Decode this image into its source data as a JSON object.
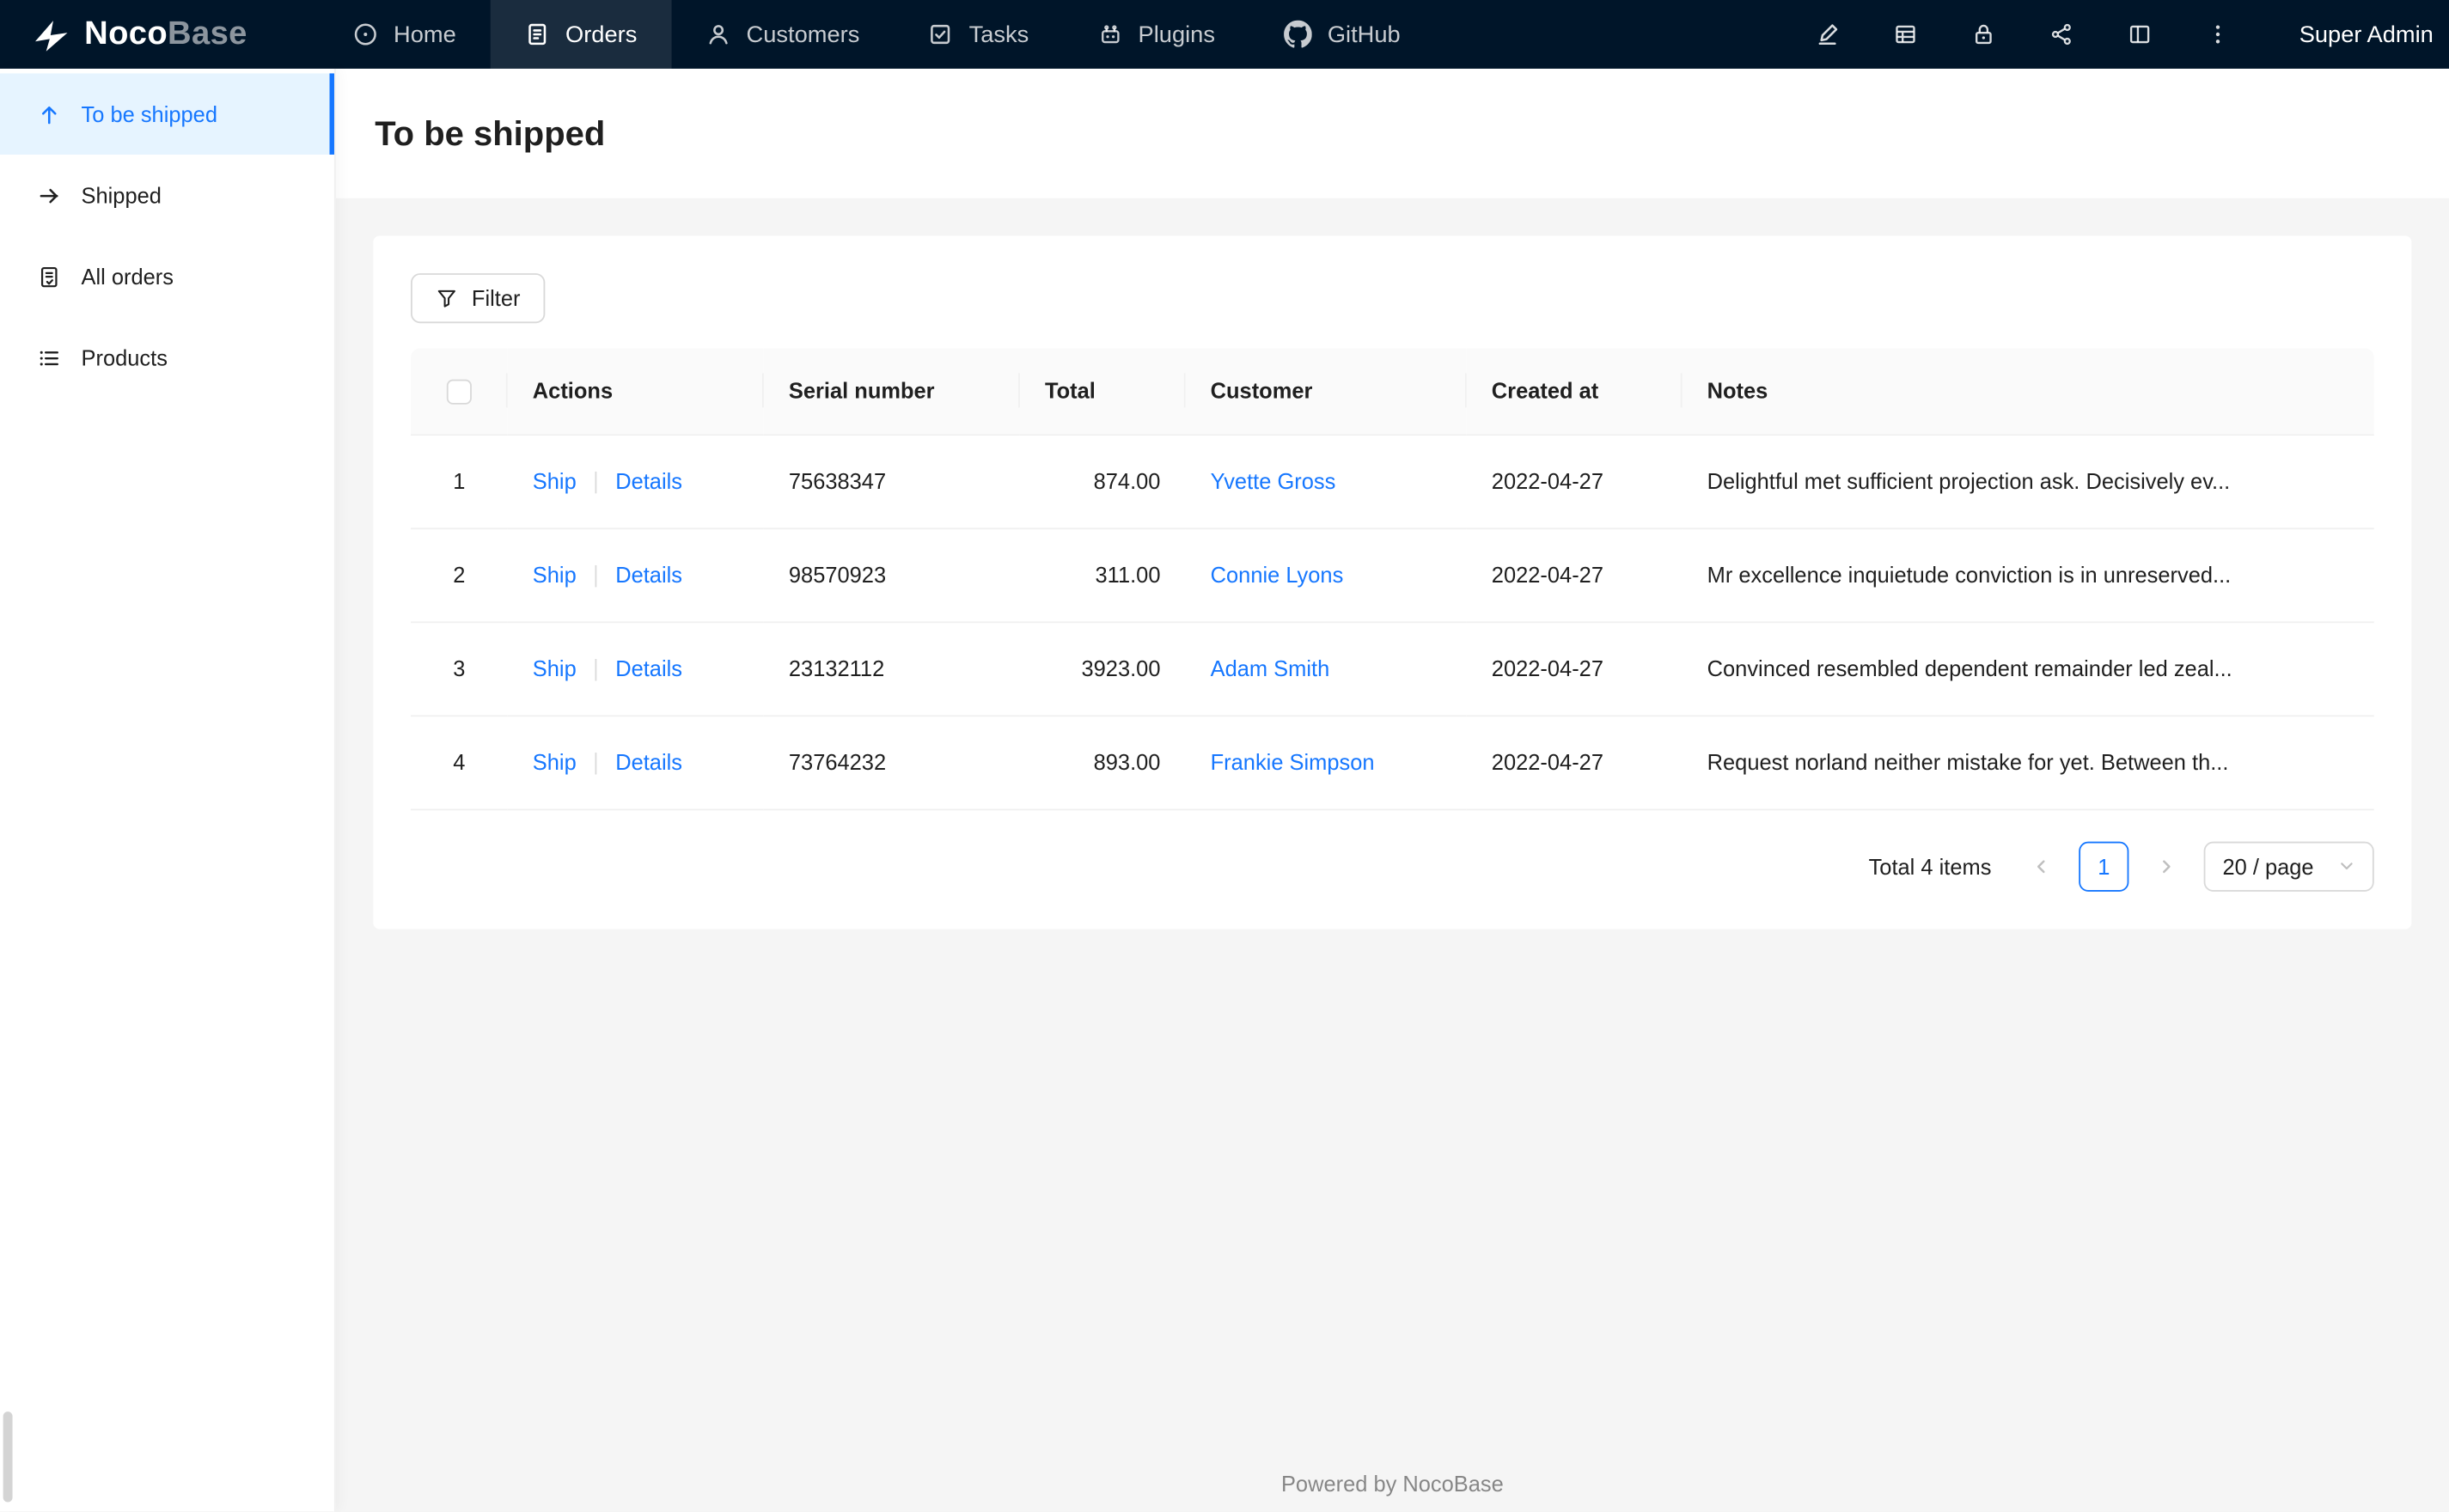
{
  "colors": {
    "accent": "#1677ff",
    "nav_bg": "#001529",
    "sidebar_selected_bg": "#e6f4ff",
    "content_bg": "#f5f5f5"
  },
  "topnav": {
    "brand": {
      "bold": "Noco",
      "light": "Base"
    },
    "items": [
      {
        "label": "Home",
        "icon": "home-icon",
        "active": false
      },
      {
        "label": "Orders",
        "icon": "orders-icon",
        "active": true
      },
      {
        "label": "Customers",
        "icon": "customers-icon",
        "active": false
      },
      {
        "label": "Tasks",
        "icon": "tasks-icon",
        "active": false
      },
      {
        "label": "Plugins",
        "icon": "plugins-icon",
        "active": false
      },
      {
        "label": "GitHub",
        "icon": "github-icon",
        "active": false
      }
    ],
    "right_icons": [
      "highlighter-icon",
      "collections-icon",
      "lock-icon",
      "nodes-icon",
      "layout-icon",
      "more-icon"
    ],
    "user": "Super Admin"
  },
  "sidebar": {
    "items": [
      {
        "label": "To be shipped",
        "icon": "arrow-up-icon",
        "active": true
      },
      {
        "label": "Shipped",
        "icon": "arrow-right-icon",
        "active": false
      },
      {
        "label": "All orders",
        "icon": "file-check-icon",
        "active": false
      },
      {
        "label": "Products",
        "icon": "list-icon",
        "active": false
      }
    ]
  },
  "page": {
    "title": "To be shipped"
  },
  "toolbar": {
    "filter_label": "Filter"
  },
  "table": {
    "columns": [
      "Actions",
      "Serial number",
      "Total",
      "Customer",
      "Created at",
      "Notes"
    ],
    "actions": {
      "ship": "Ship",
      "details": "Details"
    },
    "rows": [
      {
        "index": "1",
        "serial": "75638347",
        "total": "874.00",
        "customer": "Yvette Gross",
        "created_at": "2022-04-27",
        "notes": "Delightful met sufficient projection ask. Decisively ev..."
      },
      {
        "index": "2",
        "serial": "98570923",
        "total": "311.00",
        "customer": "Connie Lyons",
        "created_at": "2022-04-27",
        "notes": "Mr excellence inquietude conviction is in unreserved..."
      },
      {
        "index": "3",
        "serial": "23132112",
        "total": "3923.00",
        "customer": "Adam Smith",
        "created_at": "2022-04-27",
        "notes": "Convinced resembled dependent remainder led zeal..."
      },
      {
        "index": "4",
        "serial": "73764232",
        "total": "893.00",
        "customer": "Frankie Simpson",
        "created_at": "2022-04-27",
        "notes": "Request norland neither mistake for yet. Between th..."
      }
    ]
  },
  "pagination": {
    "total_text": "Total 4 items",
    "current_page": "1",
    "page_size": "20 / page"
  },
  "footer": {
    "text": "Powered by NocoBase"
  }
}
